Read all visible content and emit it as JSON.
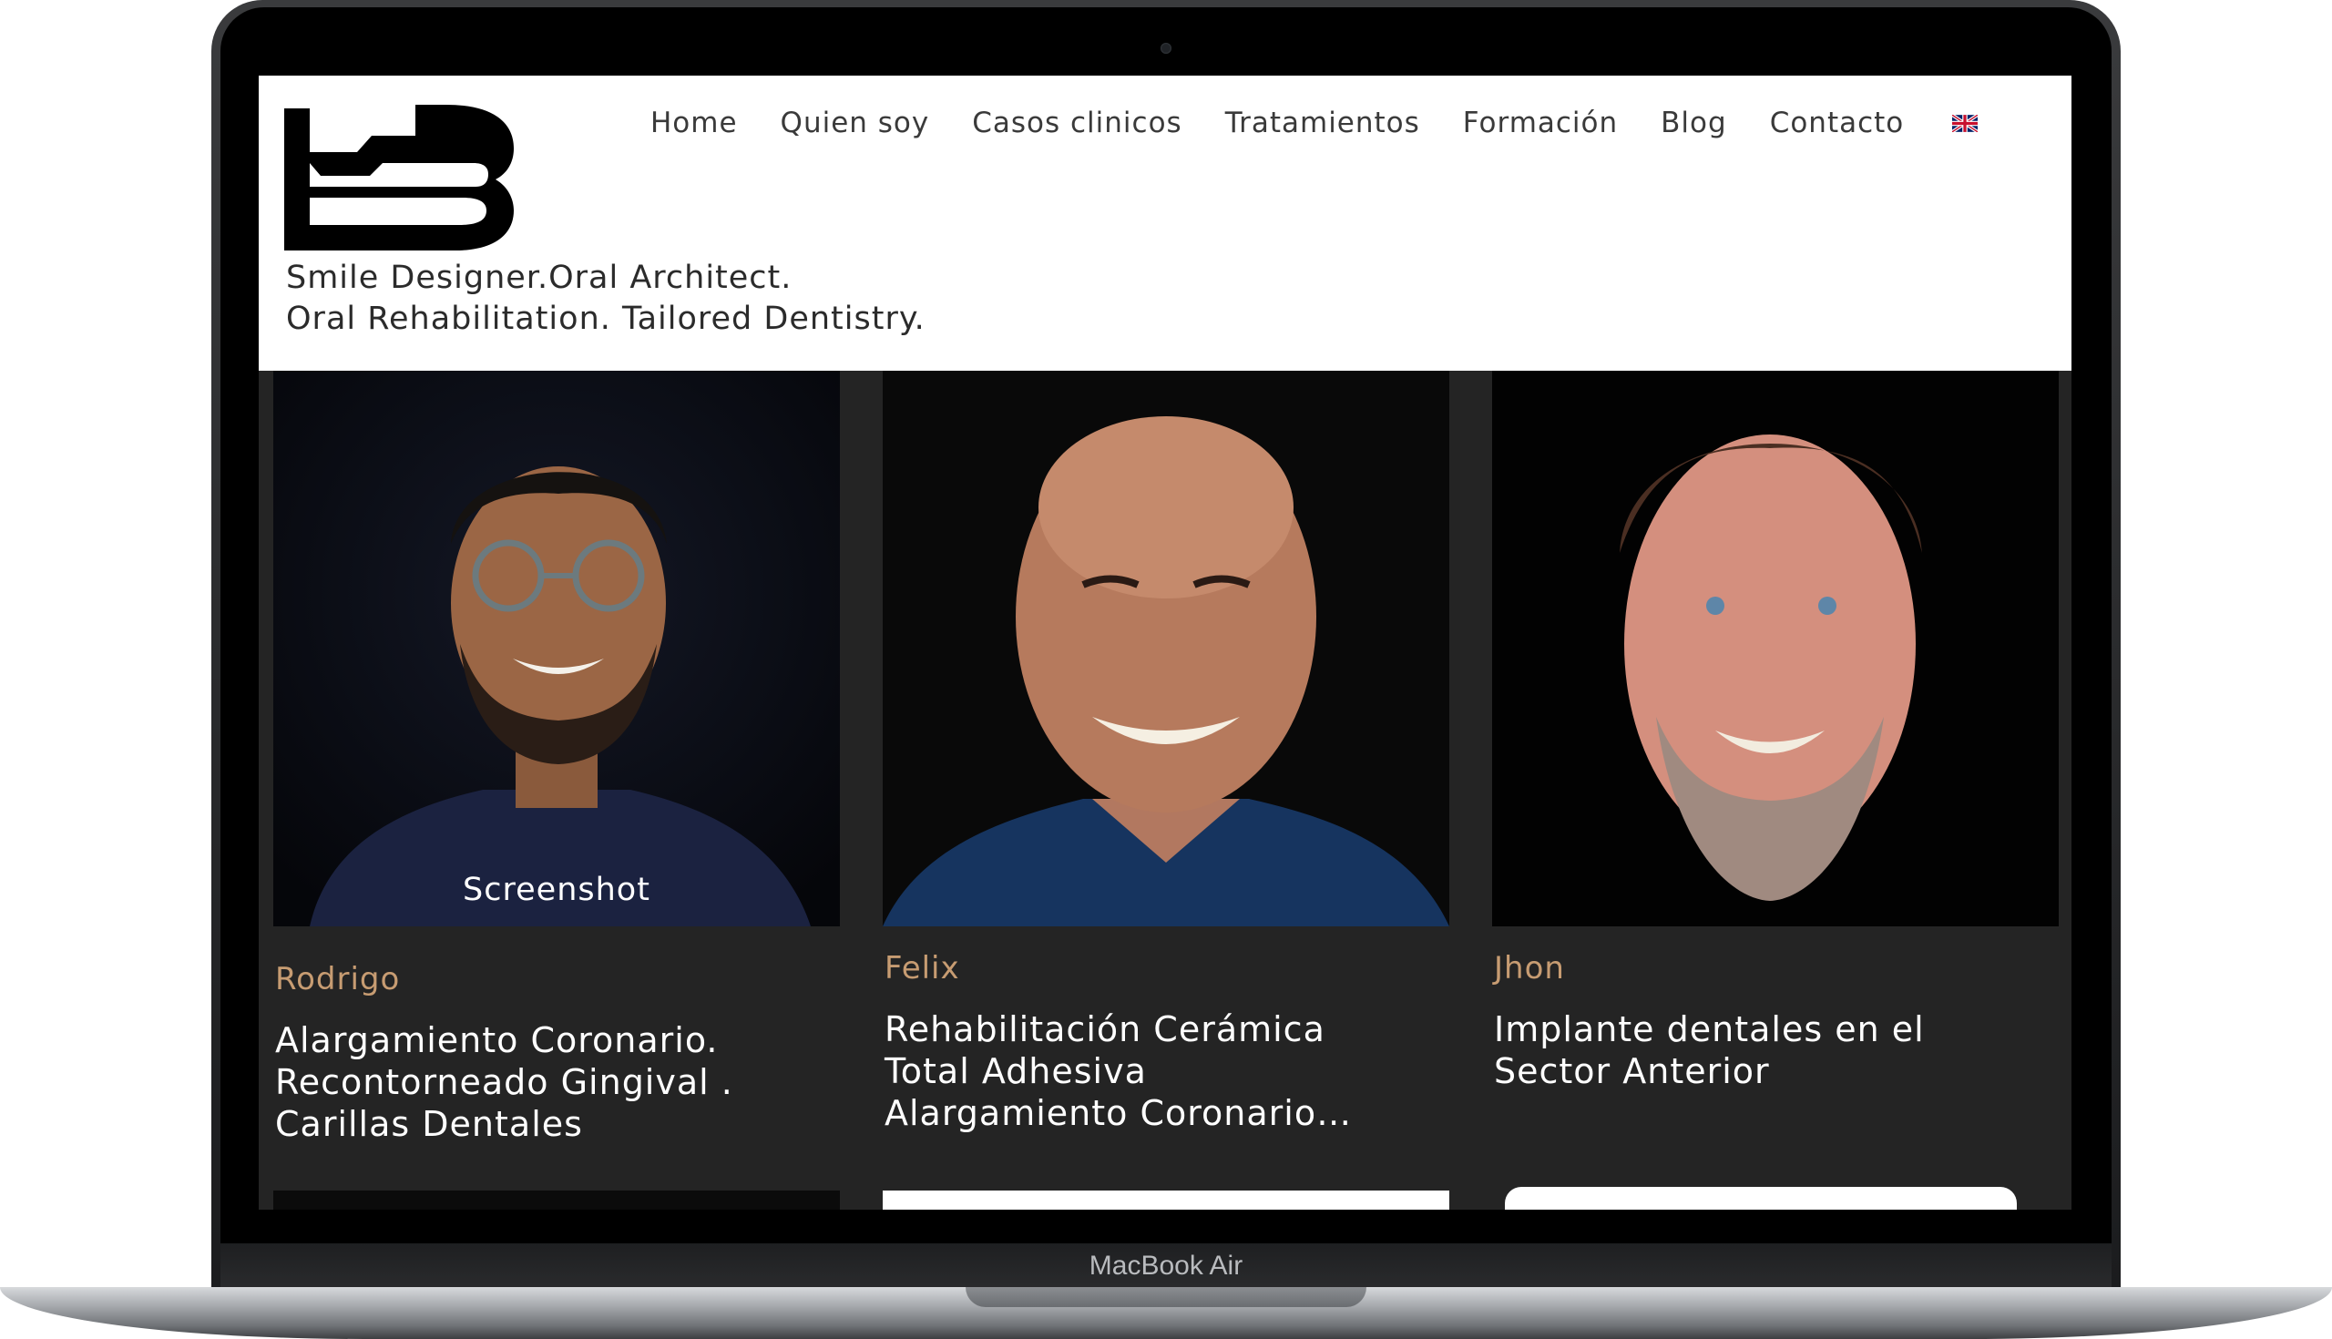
{
  "device": {
    "label": "MacBook Air"
  },
  "site": {
    "tagline_line1": "Smile Designer.Oral Architect.",
    "tagline_line2": "Oral Rehabilitation. Tailored Dentistry.",
    "nav": [
      {
        "label": "Home"
      },
      {
        "label": "Quien soy"
      },
      {
        "label": "Casos clinicos"
      },
      {
        "label": "Tratamientos"
      },
      {
        "label": "Formación"
      },
      {
        "label": "Blog"
      },
      {
        "label": "Contacto"
      }
    ],
    "language_icon": "uk-flag-icon"
  },
  "cases": [
    {
      "name": "Rodrigo",
      "title": "Alargamiento Coronario.\nRecontorneado Gingival .\nCarillas Dentales",
      "caption": "Screenshot"
    },
    {
      "name": "Felix",
      "title": "Rehabilitación Cerámica\nTotal Adhesiva\nAlargamiento Coronario…"
    },
    {
      "name": "Jhon",
      "title": "Implante dentales en el\nSector Anterior"
    }
  ],
  "colors": {
    "accent_name": "#c79c72",
    "page_bg": "#242424",
    "header_bg": "#ffffff"
  }
}
